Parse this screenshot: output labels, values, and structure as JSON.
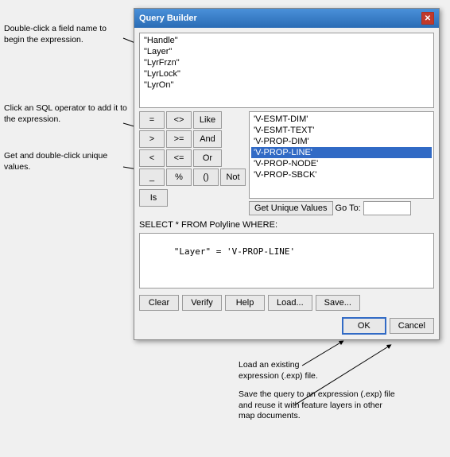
{
  "dialog": {
    "title": "Query Builder",
    "close_label": "✕"
  },
  "fields_list": {
    "items": [
      {
        "label": "\"Handle\"",
        "selected": false
      },
      {
        "label": "\"Layer\"",
        "selected": false
      },
      {
        "label": "\"LyrFrzn\"",
        "selected": false
      },
      {
        "label": "\"LyrLock\"",
        "selected": false
      },
      {
        "label": "\"LyrOn\"",
        "selected": false
      }
    ]
  },
  "operators": {
    "row1": [
      "=",
      "<>",
      "Like"
    ],
    "row2": [
      ">",
      ">=",
      "And"
    ],
    "row3": [
      "<",
      "<=",
      "Or"
    ],
    "row4": [
      "_",
      "%",
      "()",
      "Not"
    ],
    "row5": [
      "Is"
    ]
  },
  "values_list": {
    "items": [
      {
        "label": "'V-ESMT-DIM'",
        "selected": false
      },
      {
        "label": "'V-ESMT-TEXT'",
        "selected": false
      },
      {
        "label": "'V-PROP-DIM'",
        "selected": false
      },
      {
        "label": "'V-PROP-LINE'",
        "selected": true
      },
      {
        "label": "'V-PROP-NODE'",
        "selected": false
      },
      {
        "label": "'V-PROP-SBCK'",
        "selected": false
      }
    ]
  },
  "get_unique_btn": "Get Unique Values",
  "go_to_label": "Go To:",
  "go_to_value": "",
  "sql_label": "SELECT * FROM Polyline WHERE:",
  "sql_expression": "\"Layer\" = 'V-PROP-LINE'",
  "buttons": {
    "clear": "Clear",
    "verify": "Verify",
    "help": "Help",
    "load": "Load...",
    "save": "Save...",
    "ok": "OK",
    "cancel": "Cancel"
  },
  "annotations": {
    "ann1": "Double-click a field name to begin the expression.",
    "ann2": "Click an SQL operator to add it to the expression.",
    "ann3": "Get and double-click unique values.",
    "ann_load": "Load an existing expression (.exp) file.",
    "ann_save": "Save the query to an expression (.exp) file and reuse it with feature layers in other map documents."
  },
  "colors": {
    "selected_bg": "#316ac5",
    "titlebar_start": "#4a90d9",
    "titlebar_end": "#2a6cb5"
  }
}
